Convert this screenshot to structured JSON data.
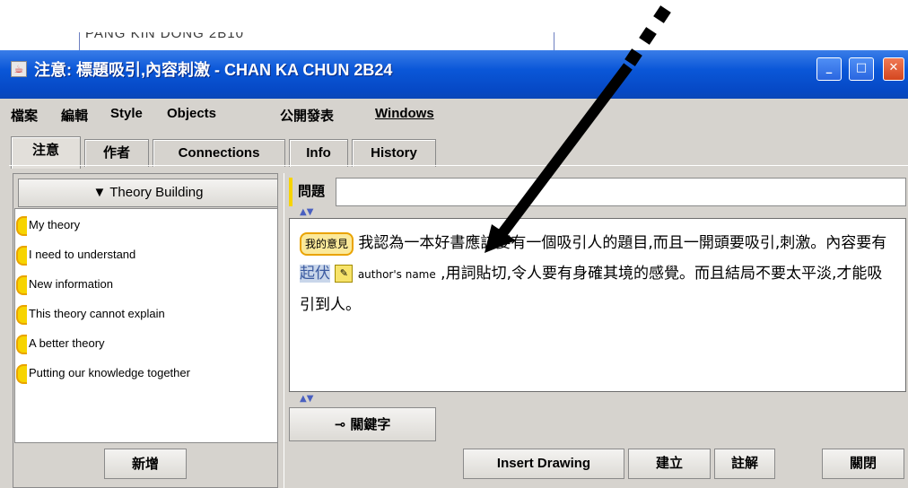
{
  "background_doc": {
    "text": "PANG KIN DONG 2B10"
  },
  "window": {
    "title": "注意: 標題吸引,內容刺激 - CHAN KA CHUN 2B24",
    "buttons": {
      "minimize": "_",
      "maximize": "□",
      "close": "✕"
    }
  },
  "menu": [
    "檔案",
    "編輯",
    "Style",
    "Objects",
    "公開發表",
    "Windows"
  ],
  "tabs": [
    "注意",
    "作者",
    "Connections",
    "Info",
    "History"
  ],
  "left_panel": {
    "dropdown_label": "▼ Theory Building",
    "items": [
      "My theory",
      "I need to understand",
      "New information",
      "This theory cannot explain",
      "A better theory",
      "Putting our knowledge together"
    ],
    "add_button": "新增"
  },
  "right_panel": {
    "question_label": "問題",
    "question_value": "",
    "content": {
      "scaffold": "我的意見",
      "text1": "我認為一本好書應該要有一個吸引人的題目,而且一開頭要吸引,刺激。內容要有",
      "highlight": "起伏",
      "author_icon": "✎",
      "author_name": "author's name",
      "text2": ",用詞貼切,令人要有身確其境的感覺。而且結局不要太平淡,才能吸引到人。"
    },
    "keyword_button": "關鍵字",
    "keyword_icon": "⊸"
  },
  "bottom_buttons": {
    "insert_drawing": "Insert Drawing",
    "create": "建立",
    "annotate": "註解",
    "close": "關閉"
  },
  "colors": {
    "title_bar": "#0a57d8",
    "scaffold": "#f7d400",
    "arrow": "#000000"
  }
}
